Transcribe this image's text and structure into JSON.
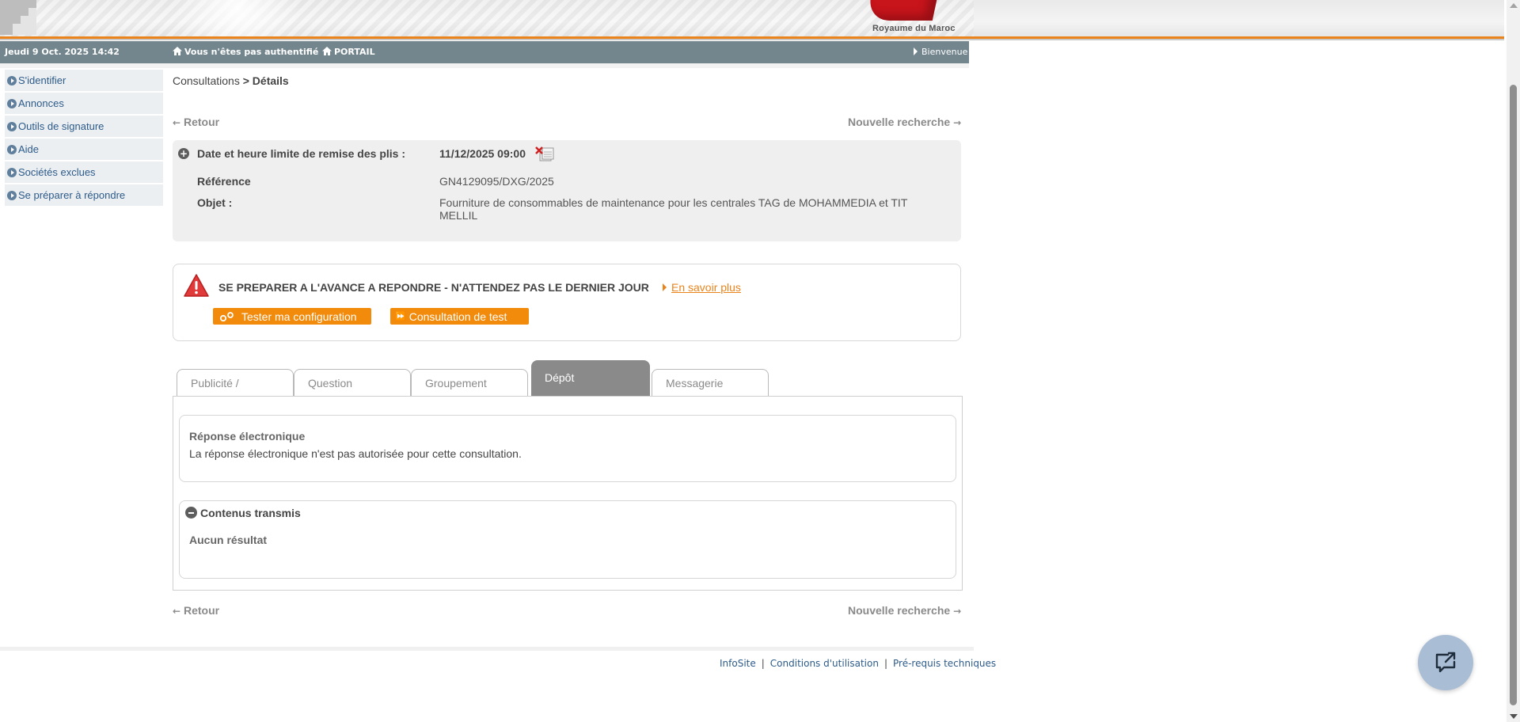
{
  "header": {
    "country": "Royaume du Maroc"
  },
  "infobar": {
    "date": "Jeudi 9 Oct. 2025 14:42",
    "auth_status": "Vous n'êtes pas authentifié",
    "portal": "PORTAIL",
    "welcome": "Bienvenue"
  },
  "sidebar": {
    "items": [
      {
        "label": "S'identifier"
      },
      {
        "label": "Annonces"
      },
      {
        "label": "Outils de signature"
      },
      {
        "label": "Aide"
      },
      {
        "label": "Sociétés exclues"
      },
      {
        "label": "Se préparer à répondre"
      }
    ]
  },
  "breadcrumb": {
    "parent": "Consultations",
    "separator": ">",
    "current": "Détails"
  },
  "nav": {
    "back": "Retour",
    "new_search": "Nouvelle recherche"
  },
  "summary": {
    "deadline_label": "Date et heure limite de remise des plis :",
    "deadline_value": "11/12/2025 09:00",
    "reference_label": "Référence",
    "reference_value": "GN4129095/DXG/2025",
    "object_label": "Objet :",
    "object_value": "Fourniture de consommables de maintenance pour les centrales TAG de MOHAMMEDIA et TIT MELLIL"
  },
  "prepare": {
    "title": "SE PREPARER A L'AVANCE A REPONDRE - N'ATTENDEZ PAS LE DERNIER JOUR",
    "learn_more": "En savoir plus",
    "test_config": "Tester ma configuration",
    "test_consultation": "Consultation de test"
  },
  "tabs": [
    {
      "label": "Publicité /",
      "active": false
    },
    {
      "label": "Question",
      "active": false
    },
    {
      "label": "Groupement",
      "active": false
    },
    {
      "label": "Dépôt",
      "active": true
    },
    {
      "label": "Messagerie",
      "active": false
    }
  ],
  "deposit": {
    "electronic_title": "Réponse électronique",
    "electronic_text": "La réponse électronique n'est pas autorisée pour cette consultation.",
    "transmitted_title": "Contenus transmis",
    "no_result": "Aucun résultat"
  },
  "footer": {
    "links": [
      "InfoSite",
      "Conditions d'utilisation",
      "Pré-requis techniques"
    ],
    "separator": "|"
  },
  "colors": {
    "accent_orange": "#f28a0b",
    "infobar_bg": "#73868e",
    "link_blue": "#2d5b8a",
    "active_tab": "#8a8a8a"
  },
  "icons": {
    "home": "home-icon",
    "warning": "warning-triangle-icon",
    "calendar": "calendar-icon",
    "chat": "chat-icon"
  }
}
